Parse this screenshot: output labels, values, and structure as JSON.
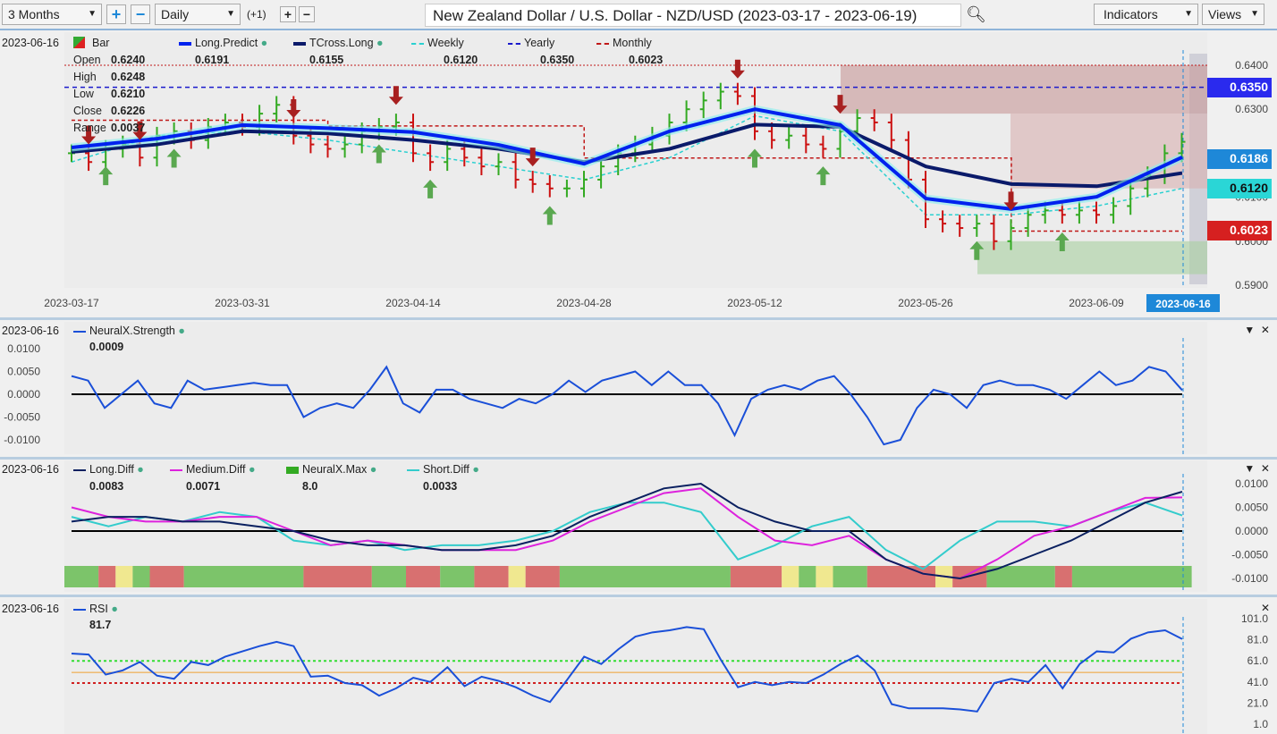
{
  "toolbar": {
    "range": "3 Months",
    "interval": "Daily",
    "offset": "(+1)",
    "title": "New Zealand Dollar / U.S. Dollar - NZD/USD (2023-03-17 - 2023-06-19)",
    "indicators": "Indicators",
    "views": "Views"
  },
  "colors": {
    "long_predict": "#0022ee",
    "tcross": "#0a1a6a",
    "weekly": "#2ad0d0",
    "yearly": "#1a1acc",
    "monthly": "#c01818",
    "up": "#33aa22",
    "down": "#cc1111",
    "long_diff": "#0a2060",
    "medium_diff": "#dd22dd",
    "short_diff": "#33cccc",
    "rsi": "#1a4fd8"
  },
  "price_panel": {
    "date": "2023-06-16",
    "bar_label": "Bar",
    "ohlc": [
      {
        "k": "Open",
        "v": "0.6240"
      },
      {
        "k": "High",
        "v": "0.6248"
      },
      {
        "k": "Low",
        "v": "0.6210"
      },
      {
        "k": "Close",
        "v": "0.6226"
      },
      {
        "k": "Range",
        "v": "0.0037"
      }
    ],
    "legend": [
      {
        "name": "Long.Predict",
        "value": "0.6191",
        "style": "solid-blue"
      },
      {
        "name": "TCross.Long",
        "value": "0.6155",
        "style": "solid-navy"
      },
      {
        "name": "Weekly",
        "value": "0.6120",
        "style": "dash-cyan"
      },
      {
        "name": "Yearly",
        "value": "0.6350",
        "style": "dash-blue"
      },
      {
        "name": "Monthly",
        "value": "0.6023",
        "style": "dash-red"
      }
    ],
    "y_ticks": [
      "0.6400",
      "0.6300",
      "0.6100",
      "0.6000",
      "0.5900"
    ],
    "y_tick_values": [
      0.64,
      0.63,
      0.61,
      0.6,
      0.59
    ],
    "tags": [
      {
        "v": "0.6350",
        "bg": "#2a2aee",
        "fg": "#fff"
      },
      {
        "v": "0.6186",
        "bg": "#1e88d8",
        "fg": "#fff"
      },
      {
        "v": "0.6120",
        "bg": "#2ad6d6",
        "fg": "#111"
      },
      {
        "v": "0.6023",
        "bg": "#d62020",
        "fg": "#fff"
      }
    ],
    "x_ticks": [
      "2023-03-17",
      "2023-03-31",
      "2023-04-14",
      "2023-04-28",
      "2023-05-12",
      "2023-05-26",
      "2023-06-09"
    ],
    "x_tick_index": [
      0,
      10,
      20,
      30,
      40,
      50,
      60
    ],
    "cursor_date": "2023-06-16",
    "closes": [
      0.62,
      0.618,
      0.621,
      0.622,
      0.619,
      0.624,
      0.625,
      0.623,
      0.626,
      0.627,
      0.626,
      0.629,
      0.631,
      0.624,
      0.622,
      0.621,
      0.622,
      0.625,
      0.626,
      0.627,
      0.62,
      0.618,
      0.621,
      0.619,
      0.617,
      0.618,
      0.614,
      0.613,
      0.612,
      0.612,
      0.614,
      0.617,
      0.62,
      0.622,
      0.624,
      0.627,
      0.63,
      0.632,
      0.634,
      0.633,
      0.625,
      0.623,
      0.624,
      0.622,
      0.621,
      0.625,
      0.628,
      0.627,
      0.623,
      0.614,
      0.605,
      0.604,
      0.603,
      0.604,
      0.6,
      0.603,
      0.606,
      0.607,
      0.606,
      0.607,
      0.606,
      0.608,
      0.612,
      0.615,
      0.62,
      0.6226
    ],
    "long_predict": [
      0.6213,
      0.6233,
      0.6264,
      0.6257,
      0.6248,
      0.6219,
      0.6176,
      0.625,
      0.63,
      0.6264,
      0.6097,
      0.6073,
      0.6101,
      0.6191
    ],
    "tcross_long": [
      0.6203,
      0.622,
      0.625,
      0.6245,
      0.623,
      0.621,
      0.618,
      0.621,
      0.6265,
      0.626,
      0.617,
      0.613,
      0.6125,
      0.6155
    ],
    "weekly": [
      0.618,
      0.624,
      0.625,
      0.623,
      0.62,
      0.617,
      0.614,
      0.619,
      0.6285,
      0.625,
      0.606,
      0.606,
      0.608,
      0.612
    ],
    "monthly": [
      0.6275,
      0.6275,
      0.6275,
      0.6262,
      0.6262,
      0.6262,
      0.6189,
      0.6189,
      0.6189,
      0.6189,
      0.6189,
      0.6023,
      0.6023,
      0.6023
    ],
    "yearly": 0.635,
    "signals": {
      "buy": [
        2,
        6,
        18,
        21,
        28,
        40,
        44,
        53,
        58
      ],
      "sell": [
        1,
        4,
        13,
        19,
        27,
        39,
        45,
        55
      ]
    }
  },
  "strength_panel": {
    "date": "2023-06-16",
    "name": "NeuralX.Strength",
    "value": "0.0009",
    "y_ticks": [
      "0.0100",
      "0.0050",
      "0.0000",
      "-0.0050",
      "-0.0100"
    ],
    "y_tick_values": [
      0.01,
      0.005,
      0,
      -0.005,
      -0.01
    ],
    "values": [
      0.004,
      0.003,
      -0.003,
      0.0,
      0.003,
      -0.002,
      -0.003,
      0.003,
      0.001,
      0.0015,
      0.002,
      0.0025,
      0.002,
      0.002,
      -0.005,
      -0.003,
      -0.002,
      -0.003,
      0.001,
      0.006,
      -0.002,
      -0.004,
      0.001,
      0.001,
      -0.001,
      -0.002,
      -0.003,
      -0.001,
      -0.002,
      0.0,
      0.003,
      0.0005,
      0.003,
      0.004,
      0.005,
      0.002,
      0.005,
      0.002,
      0.002,
      -0.002,
      -0.009,
      -0.001,
      0.001,
      0.002,
      0.001,
      0.003,
      0.004,
      0.0,
      -0.005,
      -0.011,
      -0.01,
      -0.003,
      0.001,
      0.0,
      -0.003,
      0.002,
      0.003,
      0.002,
      0.002,
      0.001,
      -0.001,
      0.002,
      0.005,
      0.002,
      0.003,
      0.006,
      0.005,
      0.0009
    ]
  },
  "diff_panel": {
    "date": "2023-06-16",
    "legend": [
      {
        "name": "Long.Diff",
        "value": "0.0083"
      },
      {
        "name": "Medium.Diff",
        "value": "0.0071"
      },
      {
        "name": "NeuralX.Max",
        "value": "8.0"
      },
      {
        "name": "Short.Diff",
        "value": "0.0033"
      }
    ],
    "y_ticks": [
      "0.0100",
      "0.0050",
      "0.0000",
      "-0.0050",
      "-0.0100"
    ],
    "y_tick_values": [
      0.01,
      0.005,
      0,
      -0.005,
      -0.01
    ],
    "long_diff": [
      0.002,
      0.003,
      0.003,
      0.002,
      0.002,
      0.001,
      0.0,
      -0.002,
      -0.003,
      -0.003,
      -0.004,
      -0.004,
      -0.003,
      -0.001,
      0.003,
      0.006,
      0.009,
      0.01,
      0.005,
      0.002,
      0.0,
      0.0,
      -0.006,
      -0.009,
      -0.01,
      -0.008,
      -0.005,
      -0.002,
      0.002,
      0.006,
      0.0083
    ],
    "medium_diff": [
      0.005,
      0.003,
      0.002,
      0.002,
      0.003,
      0.003,
      0.0,
      -0.003,
      -0.002,
      -0.003,
      -0.004,
      -0.004,
      -0.004,
      -0.002,
      0.002,
      0.005,
      0.008,
      0.009,
      0.003,
      -0.002,
      -0.003,
      -0.001,
      -0.006,
      -0.009,
      -0.01,
      -0.006,
      -0.001,
      0.001,
      0.004,
      0.007,
      0.0071
    ],
    "short_diff": [
      0.003,
      0.001,
      0.003,
      0.002,
      0.004,
      0.003,
      -0.002,
      -0.003,
      -0.002,
      -0.004,
      -0.003,
      -0.003,
      -0.002,
      0.0,
      0.004,
      0.006,
      0.006,
      0.004,
      -0.006,
      -0.003,
      0.001,
      0.003,
      -0.004,
      -0.008,
      -0.002,
      0.002,
      0.002,
      0.001,
      0.004,
      0.006,
      0.0033
    ],
    "max_band": [
      [
        "g",
        2
      ],
      [
        "r",
        1
      ],
      [
        "y",
        1
      ],
      [
        "g",
        1
      ],
      [
        "r",
        2
      ],
      [
        "g",
        7
      ],
      [
        "r",
        4
      ],
      [
        "g",
        2
      ],
      [
        "r",
        2
      ],
      [
        "g",
        2
      ],
      [
        "r",
        2
      ],
      [
        "y",
        1
      ],
      [
        "r",
        2
      ],
      [
        "g",
        10
      ],
      [
        "r",
        3
      ],
      [
        "y",
        1
      ],
      [
        "g",
        1
      ],
      [
        "y",
        1
      ],
      [
        "g",
        2
      ],
      [
        "r",
        4
      ],
      [
        "y",
        1
      ],
      [
        "r",
        2
      ],
      [
        "g",
        4
      ],
      [
        "r",
        1
      ],
      [
        "g",
        7
      ]
    ],
    "band_colors": {
      "g": "#7cc46a",
      "r": "#d87070",
      "y": "#f0e890"
    }
  },
  "rsi_panel": {
    "date": "2023-06-16",
    "name": "RSI",
    "value": "81.7",
    "y_ticks": [
      "101.0",
      "81.0",
      "61.0",
      "41.0",
      "21.0",
      "1.0"
    ],
    "y_tick_values": [
      101,
      81,
      61,
      41,
      21,
      1
    ],
    "levels": {
      "upper": 61,
      "mid": 50,
      "lower": 40
    },
    "values": [
      68,
      67,
      48,
      52,
      60,
      47,
      44,
      60,
      57,
      65,
      70,
      75,
      79,
      75,
      46,
      47,
      40,
      38,
      28,
      35,
      45,
      41,
      55,
      37,
      46,
      42,
      36,
      28,
      22,
      43,
      65,
      58,
      72,
      84,
      88,
      90,
      93,
      91,
      62,
      36,
      41,
      38,
      41,
      40,
      48,
      58,
      66,
      52,
      20,
      16,
      16,
      16,
      15,
      13,
      40,
      44,
      41,
      57,
      35,
      58,
      70,
      69,
      82,
      88,
      90,
      81.7
    ]
  }
}
